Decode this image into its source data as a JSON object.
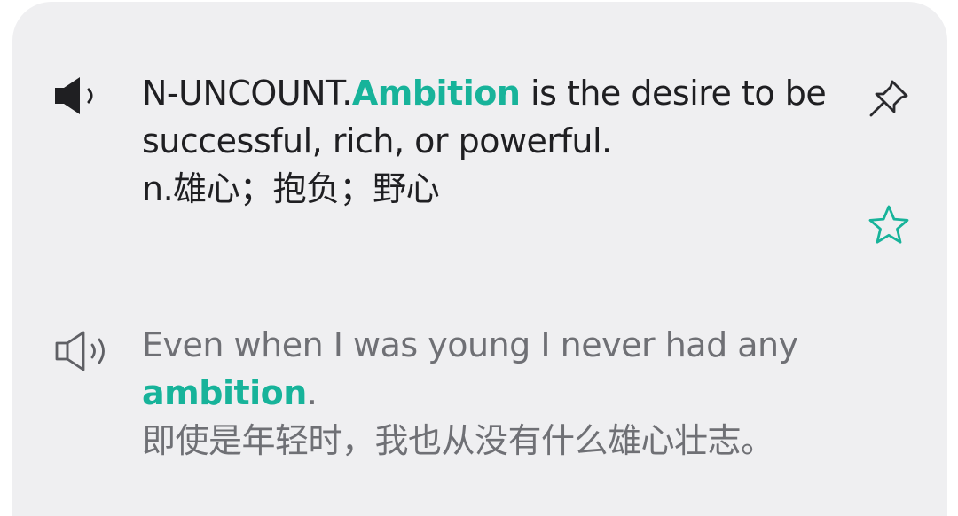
{
  "definition": {
    "pos": "N-UNCOUNT.",
    "headword": "Ambition",
    "text_line1": " is the desire to be",
    "text_line2": "successful, rich, or powerful.",
    "translation": "n.雄心；抱负；野心",
    "audio_icon": "speaker-filled-icon",
    "pin_icon": "pin-icon",
    "favorite_icon": "star-outline-icon"
  },
  "example": {
    "text_line1": "Even when I was young I never had any",
    "keyword": "ambition",
    "punct": ".",
    "translation": "即使是年轻时，我也从没有什么雄心壮志。",
    "audio_icon": "speaker-outline-icon"
  },
  "colors": {
    "accent": "#17b39a",
    "card_bg": "#efeff1",
    "primary_text": "#1f1f22",
    "secondary_text": "#6f7075"
  }
}
